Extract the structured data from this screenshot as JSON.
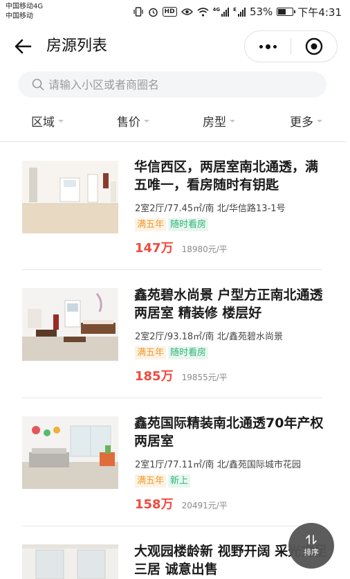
{
  "status_bar": {
    "carrier1": "中国移动4G",
    "carrier2": "中国移动",
    "battery": "53%",
    "time": "下午4:31",
    "hd_label": "HD",
    "net_4g": "4G",
    "net_e": "E",
    "battery_level": 0.53
  },
  "nav": {
    "title": "房源列表"
  },
  "search": {
    "placeholder": "请输入小区或者商圈名"
  },
  "filters": [
    "区域",
    "售价",
    "房型",
    "更多"
  ],
  "listings": [
    {
      "title": "华信西区，两居室南北通透，满五唯一，看房随时有钥匙",
      "meta": "2室2厅/77.45㎡/南 北/华信路13-1号",
      "tags": [
        "满五年",
        "随时看房"
      ],
      "price": "147万",
      "unit_price": "18980元/平"
    },
    {
      "title": "鑫苑碧水尚景 户型方正南北通透两居室 精装修 楼层好",
      "meta": "2室2厅/93.18㎡/南 北/鑫苑碧水尚景",
      "tags": [
        "满五年",
        "随时看房"
      ],
      "price": "185万",
      "unit_price": "19855元/平"
    },
    {
      "title": "鑫苑国际精装南北通透70年产权两居室",
      "meta": "2室1厅/77.11㎡/南 北/鑫苑国际城市花园",
      "tags": [
        "满五年",
        "新上"
      ],
      "price": "158万",
      "unit_price": "20491元/平"
    },
    {
      "title": "大观园楼龄新 视野开阔 采光充足三居 诚意出售",
      "meta": "",
      "tags": [],
      "price": "",
      "unit_price": ""
    }
  ],
  "sort_fab": {
    "label": "排序"
  },
  "colors": {
    "price": "#f04a3e",
    "tag_orange": "#f39a2f",
    "tag_green": "#2fb577",
    "fab_bg": "#545454"
  }
}
